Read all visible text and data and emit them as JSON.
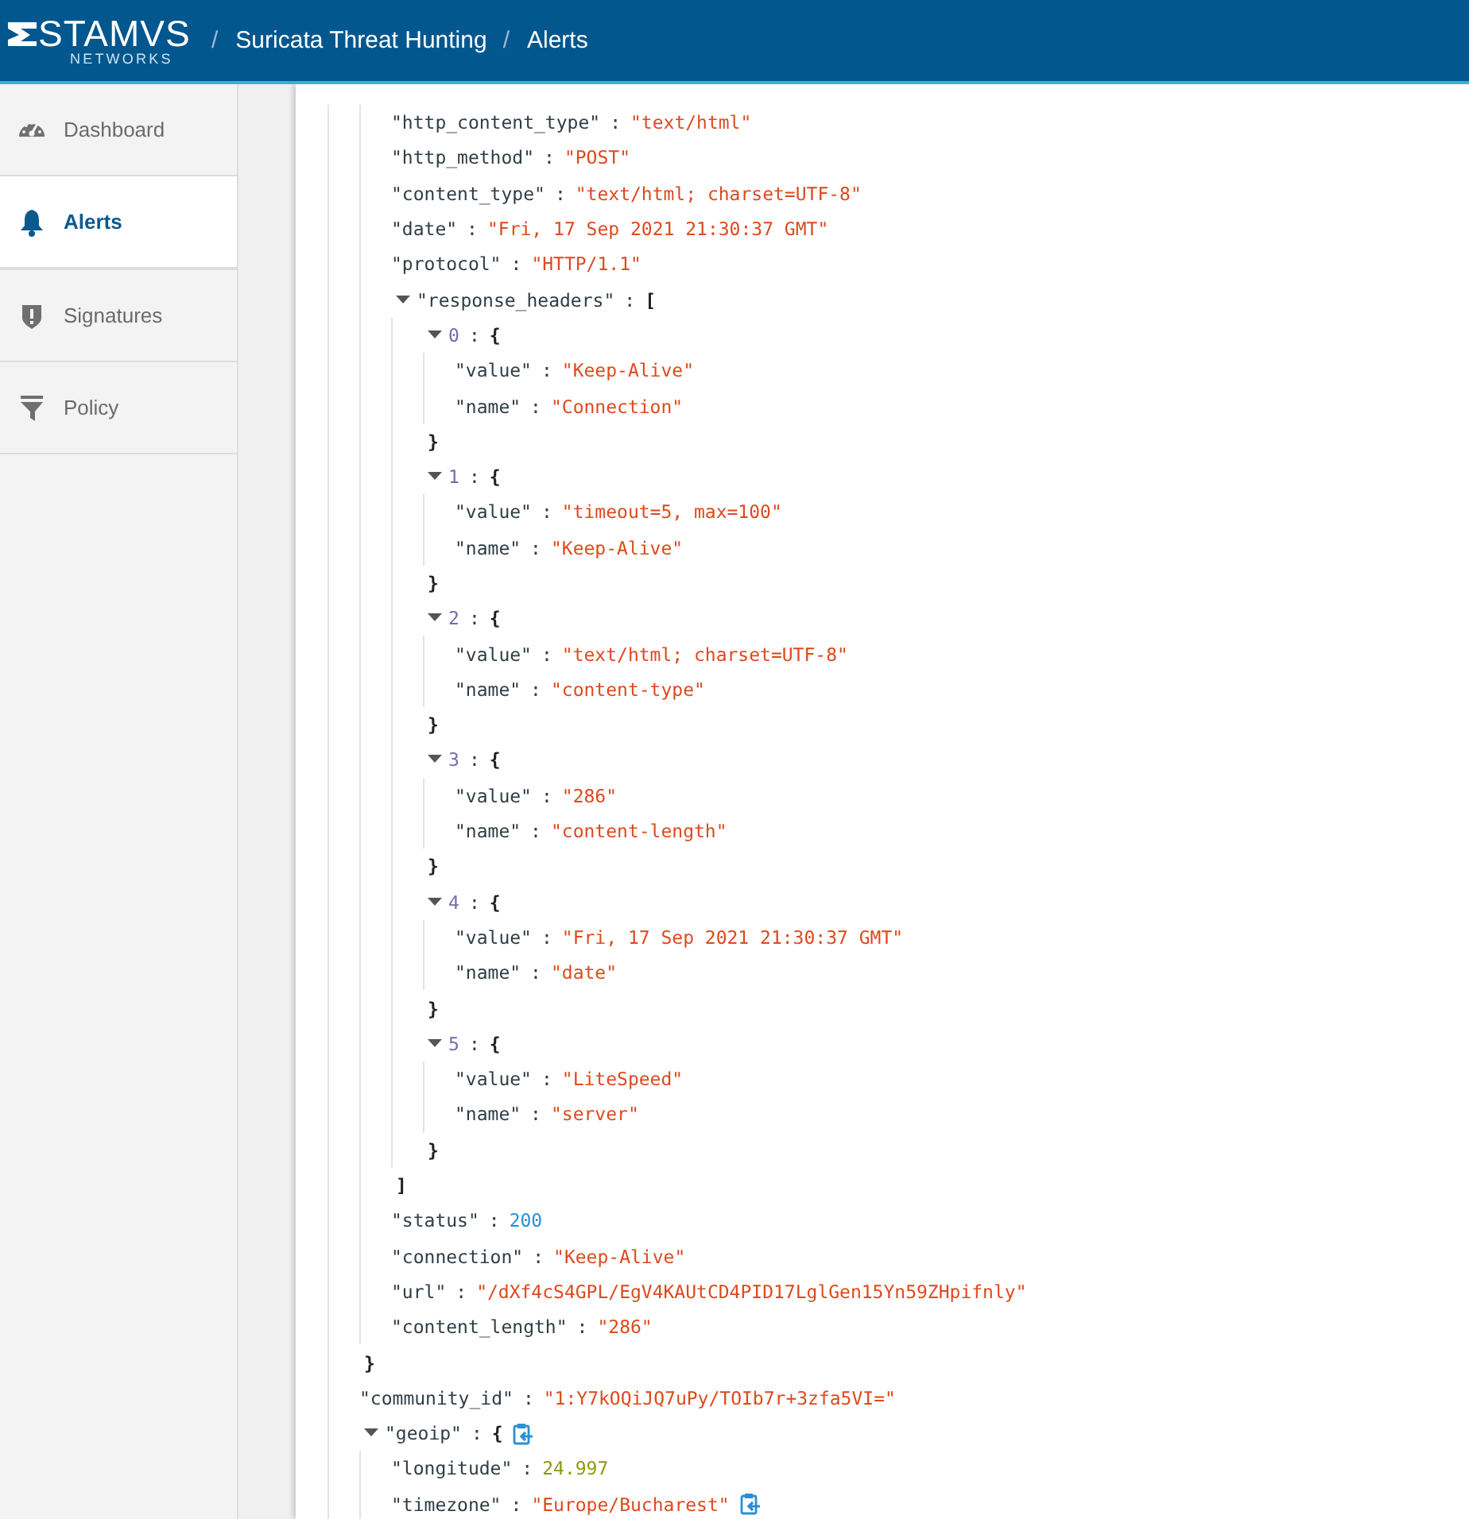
{
  "header": {
    "logo": {
      "wordmark": "STAMVS",
      "tagline": "NETWORKS"
    },
    "breadcrumb": [
      {
        "sep": "/",
        "label": "Suricata Threat Hunting"
      },
      {
        "sep": "/",
        "label": "Alerts"
      }
    ]
  },
  "sidebar": {
    "items": [
      {
        "label": "Dashboard",
        "selected": false
      },
      {
        "label": "Alerts",
        "selected": true
      },
      {
        "label": "Signatures",
        "selected": false
      },
      {
        "label": "Policy",
        "selected": false
      }
    ]
  },
  "tree": [
    {
      "kind": "object",
      "close": "}",
      "children": [
        {
          "kind": "string",
          "key": "\"http_content_type\"",
          "sep": ":",
          "value": "\"text/html\""
        },
        {
          "kind": "string",
          "key": "\"http_method\"",
          "sep": ":",
          "value": "\"POST\""
        },
        {
          "kind": "string",
          "key": "\"content_type\"",
          "sep": ":",
          "value": "\"text/html; charset=UTF-8\""
        },
        {
          "kind": "string",
          "key": "\"date\"",
          "sep": ":",
          "value": "\"Fri, 17 Sep 2021 21:30:37 GMT\""
        },
        {
          "kind": "string",
          "key": "\"protocol\"",
          "sep": ":",
          "value": "\"HTTP/1.1\""
        },
        {
          "kind": "array",
          "key": "\"response_headers\"",
          "sep": ":",
          "open": "[",
          "close": "]",
          "expanded": true,
          "children": [
            {
              "kind": "object",
              "index": "0",
              "sep": ":",
              "open": "{",
              "close": "}",
              "expanded": true,
              "children": [
                {
                  "kind": "string",
                  "key": "\"value\"",
                  "sep": ":",
                  "value": "\"Keep-Alive\""
                },
                {
                  "kind": "string",
                  "key": "\"name\"",
                  "sep": ":",
                  "value": "\"Connection\""
                }
              ]
            },
            {
              "kind": "object",
              "index": "1",
              "sep": ":",
              "open": "{",
              "close": "}",
              "expanded": true,
              "children": [
                {
                  "kind": "string",
                  "key": "\"value\"",
                  "sep": ":",
                  "value": "\"timeout=5, max=100\""
                },
                {
                  "kind": "string",
                  "key": "\"name\"",
                  "sep": ":",
                  "value": "\"Keep-Alive\""
                }
              ]
            },
            {
              "kind": "object",
              "index": "2",
              "sep": ":",
              "open": "{",
              "close": "}",
              "expanded": true,
              "children": [
                {
                  "kind": "string",
                  "key": "\"value\"",
                  "sep": ":",
                  "value": "\"text/html; charset=UTF-8\""
                },
                {
                  "kind": "string",
                  "key": "\"name\"",
                  "sep": ":",
                  "value": "\"content-type\""
                }
              ]
            },
            {
              "kind": "object",
              "index": "3",
              "sep": ":",
              "open": "{",
              "close": "}",
              "expanded": true,
              "children": [
                {
                  "kind": "string",
                  "key": "\"value\"",
                  "sep": ":",
                  "value": "\"286\""
                },
                {
                  "kind": "string",
                  "key": "\"name\"",
                  "sep": ":",
                  "value": "\"content-length\""
                }
              ]
            },
            {
              "kind": "object",
              "index": "4",
              "sep": ":",
              "open": "{",
              "close": "}",
              "expanded": true,
              "children": [
                {
                  "kind": "string",
                  "key": "\"value\"",
                  "sep": ":",
                  "value": "\"Fri, 17 Sep 2021 21:30:37 GMT\""
                },
                {
                  "kind": "string",
                  "key": "\"name\"",
                  "sep": ":",
                  "value": "\"date\""
                }
              ]
            },
            {
              "kind": "object",
              "index": "5",
              "sep": ":",
              "open": "{",
              "close": "}",
              "expanded": true,
              "children": [
                {
                  "kind": "string",
                  "key": "\"value\"",
                  "sep": ":",
                  "value": "\"LiteSpeed\""
                },
                {
                  "kind": "string",
                  "key": "\"name\"",
                  "sep": ":",
                  "value": "\"server\""
                }
              ]
            }
          ]
        },
        {
          "kind": "integer",
          "key": "\"status\"",
          "sep": ":",
          "value": "200"
        },
        {
          "kind": "string",
          "key": "\"connection\"",
          "sep": ":",
          "value": "\"Keep-Alive\""
        },
        {
          "kind": "string",
          "key": "\"url\"",
          "sep": ":",
          "value": "\"/dXf4cS4GPL/EgV4KAUtCD4PID17LglGen15Yn59ZHpifnly\""
        },
        {
          "kind": "string",
          "key": "\"content_length\"",
          "sep": ":",
          "value": "\"286\""
        }
      ]
    },
    {
      "kind": "string",
      "key": "\"community_id\"",
      "sep": ":",
      "value": "\"1:Y7kOQiJQ7uPy/TOIb7r+3zfa5VI=\""
    },
    {
      "kind": "object",
      "key": "\"geoip\"",
      "sep": ":",
      "open": "{",
      "expanded": true,
      "copy": true,
      "children": [
        {
          "kind": "float",
          "key": "\"longitude\"",
          "sep": ":",
          "value": "24.997"
        },
        {
          "kind": "string",
          "key": "\"timezone\"",
          "sep": ":",
          "value": "\"Europe/Bucharest\"",
          "copy": true
        }
      ]
    }
  ]
}
